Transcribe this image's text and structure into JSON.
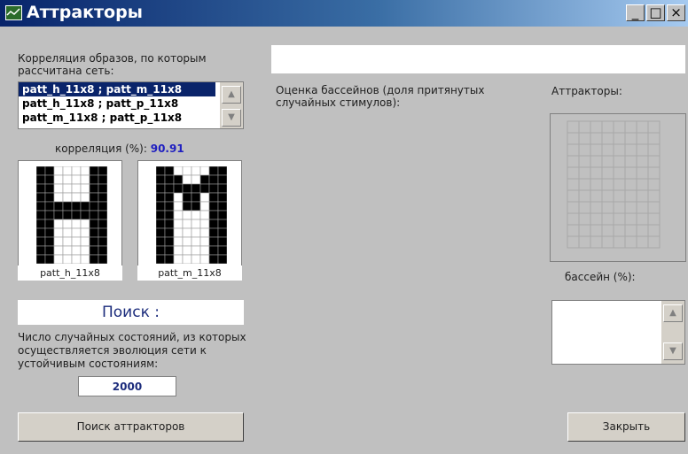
{
  "window": {
    "title": "Аттракторы",
    "minimize": "_",
    "maximize": "□",
    "close": "×"
  },
  "left": {
    "corr_heading": "Корреляция образов, по которым рассчитана сеть:",
    "pairs": [
      "patt_h_11x8 ; patt_m_11x8",
      "patt_h_11x8 ; patt_p_11x8",
      "patt_m_11x8 ; patt_p_11x8"
    ],
    "corr_label": "корреляция (%):",
    "corr_value": "90.91",
    "pattern1_name": "patt_h_11x8",
    "pattern2_name": "patt_m_11x8",
    "search_title": "Поиск :",
    "random_states_text": "Число случайных состояний, из которых осуществляется эволюция сети к устойчивым состояниям:",
    "random_states_value": "2000",
    "search_button": "Поиск аттракторов"
  },
  "middle": {
    "top_field_value": "",
    "basins_heading": "Оценка бассейнов (доля притянутых случайных стимулов):"
  },
  "right": {
    "attractors_heading": "Аттракторы:",
    "basin_label": "бассейн (%):",
    "close_button": "Закрыть"
  }
}
